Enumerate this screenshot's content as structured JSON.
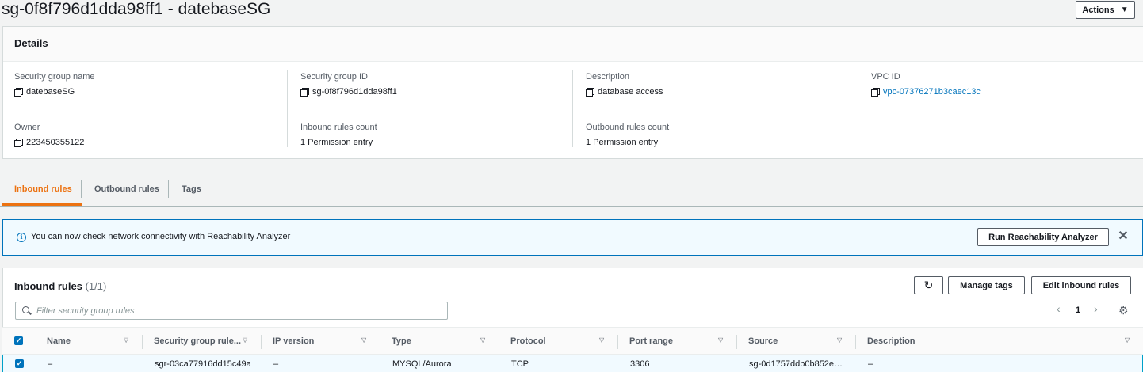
{
  "header": {
    "title": "sg-0f8f796d1dda98ff1 - datebaseSG",
    "actions_label": "Actions",
    "actions_caret": "▼"
  },
  "details": {
    "title": "Details",
    "fields": [
      {
        "label": "Security group name",
        "value": "datebaseSG"
      },
      {
        "label": "Security group ID",
        "value": "sg-0f8f796d1dda98ff1"
      },
      {
        "label": "Description",
        "value": "database access"
      },
      {
        "label": "VPC ID",
        "value": "vpc-07376271b3caec13c"
      },
      {
        "label": "Owner",
        "value": "223450355122"
      },
      {
        "label": "Inbound rules count",
        "value": "1 Permission entry"
      },
      {
        "label": "Outbound rules count",
        "value": "1 Permission entry"
      }
    ]
  },
  "tabs": [
    {
      "label": "Inbound rules",
      "active": true
    },
    {
      "label": "Outbound rules",
      "active": false
    },
    {
      "label": "Tags",
      "active": false
    }
  ],
  "banner": {
    "icon": "info-icon",
    "text": "You can now check network connectivity with Reachability Analyzer",
    "button_label": "Run Reachability Analyzer",
    "close_glyph": "✕"
  },
  "rules": {
    "title": "Inbound rules",
    "count": "(1/1)",
    "refresh_glyph": "↻",
    "manage_tags_label": "Manage tags",
    "edit_label": "Edit inbound rules",
    "search_placeholder": "Filter security group rules",
    "page_number": "1",
    "prev_glyph": "‹",
    "next_glyph": "›",
    "settings_glyph": "⚙",
    "columns": [
      "Name",
      "Security group rule...",
      "IP version",
      "Type",
      "Protocol",
      "Port range",
      "Source",
      "Description"
    ],
    "rows": [
      {
        "selected": true,
        "cells": [
          "–",
          "sgr-03ca77916dd15c49a",
          "–",
          "MYSQL/Aurora",
          "TCP",
          "3306",
          "sg-0d1757ddb0b852e…",
          "–"
        ]
      }
    ]
  },
  "colors": {
    "accent": "#ec7211",
    "link": "#0073bb",
    "info_bg": "#f1faff"
  }
}
